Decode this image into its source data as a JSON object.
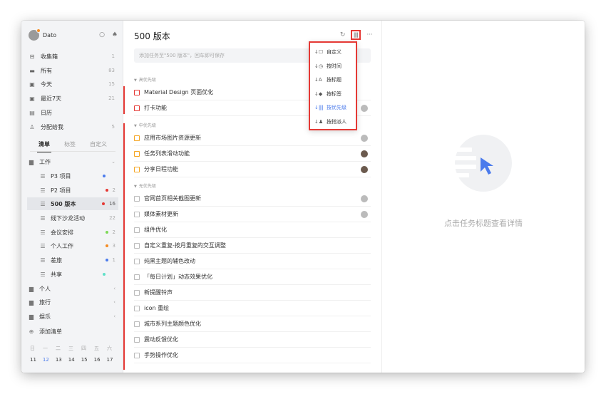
{
  "sidebar": {
    "user": "Dato",
    "nav": [
      {
        "icon": "inbox-icon",
        "label": "收集箱",
        "count": "1"
      },
      {
        "icon": "all-icon",
        "label": "所有",
        "count": "83"
      },
      {
        "icon": "today-icon",
        "label": "今天",
        "count": "15"
      },
      {
        "icon": "week-icon",
        "label": "最近7天",
        "count": "21"
      },
      {
        "icon": "calendar-icon",
        "label": "日历",
        "count": ""
      },
      {
        "icon": "assigned-icon",
        "label": "分配给我",
        "count": "5"
      }
    ],
    "tabs": [
      "清单",
      "标签",
      "自定义"
    ],
    "lists": [
      {
        "label": "工作"
      },
      {
        "label": "P3 项目",
        "dot": "#4b7bec"
      },
      {
        "label": "P2 项目",
        "dot": "#e53935",
        "count": "2"
      },
      {
        "label": "500 版本",
        "dot": "#e53935",
        "count": "16"
      },
      {
        "label": "线下沙龙活动",
        "count": "22"
      },
      {
        "label": "会议安排",
        "dot": "#7ed957",
        "count": "2"
      },
      {
        "label": "个人工作",
        "dot": "#f58c23",
        "count": "3"
      },
      {
        "label": "差旅",
        "dot": "#4b7bec",
        "count": "1"
      },
      {
        "label": "共享",
        "dot": "#5fe0c8"
      },
      {
        "label": "个人"
      },
      {
        "label": "旅行"
      },
      {
        "label": "娱乐"
      },
      {
        "label": "添加清单"
      }
    ],
    "week_days": [
      "日",
      "一",
      "二",
      "三",
      "四",
      "五",
      "六"
    ],
    "week_dates": [
      "11",
      "12",
      "13",
      "14",
      "15",
      "16",
      "17"
    ]
  },
  "main": {
    "title": "500 版本",
    "add_placeholder": "添加任务至\"500 版本\"，回车即可保存",
    "groups": [
      "高优先级",
      "中优先级",
      "无优先级"
    ],
    "tasks": [
      "Material Design 页面优化",
      "打卡功能",
      "应用市场图片资源更新",
      "任务列表滑动功能",
      "分享日程功能",
      "官网首页相关截图更新",
      "媒体素材更新",
      "组件优化",
      "自定义重复-按月重复的交互调整",
      "纯黑主题的辅色改动",
      "「每日计划」动态效果优化",
      "新提醒铃声",
      "icon 重绘",
      "城市系列主题颜色优化",
      "震动反馈优化",
      "手势操作优化"
    ]
  },
  "sort_menu": {
    "items": [
      "自定义",
      "按时间",
      "按标题",
      "按标签",
      "按优先级",
      "按指派人"
    ],
    "active": "按优先级"
  },
  "detail": {
    "hint": "点击任务标题查看详情"
  },
  "colors": {
    "accent": "#4b7bec",
    "high_priority": "#e53935",
    "medium_priority": "#f5a623",
    "highlight_border": "#e53935"
  }
}
